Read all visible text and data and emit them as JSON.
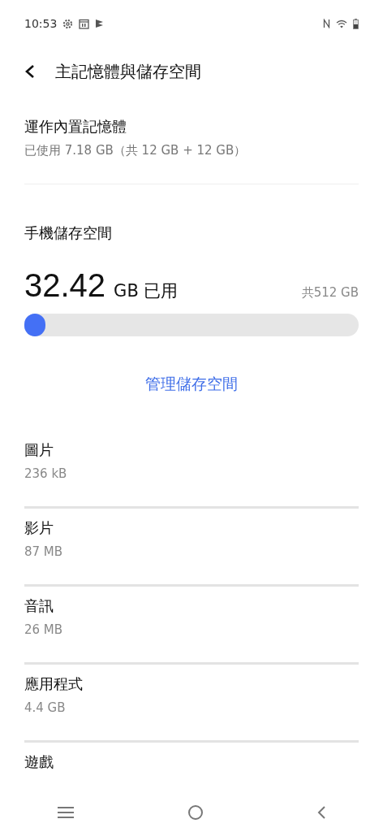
{
  "status_bar": {
    "time": "10:53"
  },
  "header": {
    "title": "主記憶體與儲存空間"
  },
  "memory": {
    "title": "運作內置記憶體",
    "summary": "已使用 7.18 GB（共 12 GB + 12 GB）"
  },
  "storage": {
    "title": "手機儲存空間",
    "used": "32.42",
    "unit": "GB 已用",
    "total": "共512 GB",
    "level": 0.063,
    "manage_link": "管理儲存空間"
  },
  "categories": [
    {
      "name": "圖片",
      "size": "236 kB"
    },
    {
      "name": "影片",
      "size": "87 MB"
    },
    {
      "name": "音訊",
      "size": "26 MB"
    },
    {
      "name": "應用程式",
      "size": "4.4 GB"
    },
    {
      "name": "遊戲"
    }
  ]
}
